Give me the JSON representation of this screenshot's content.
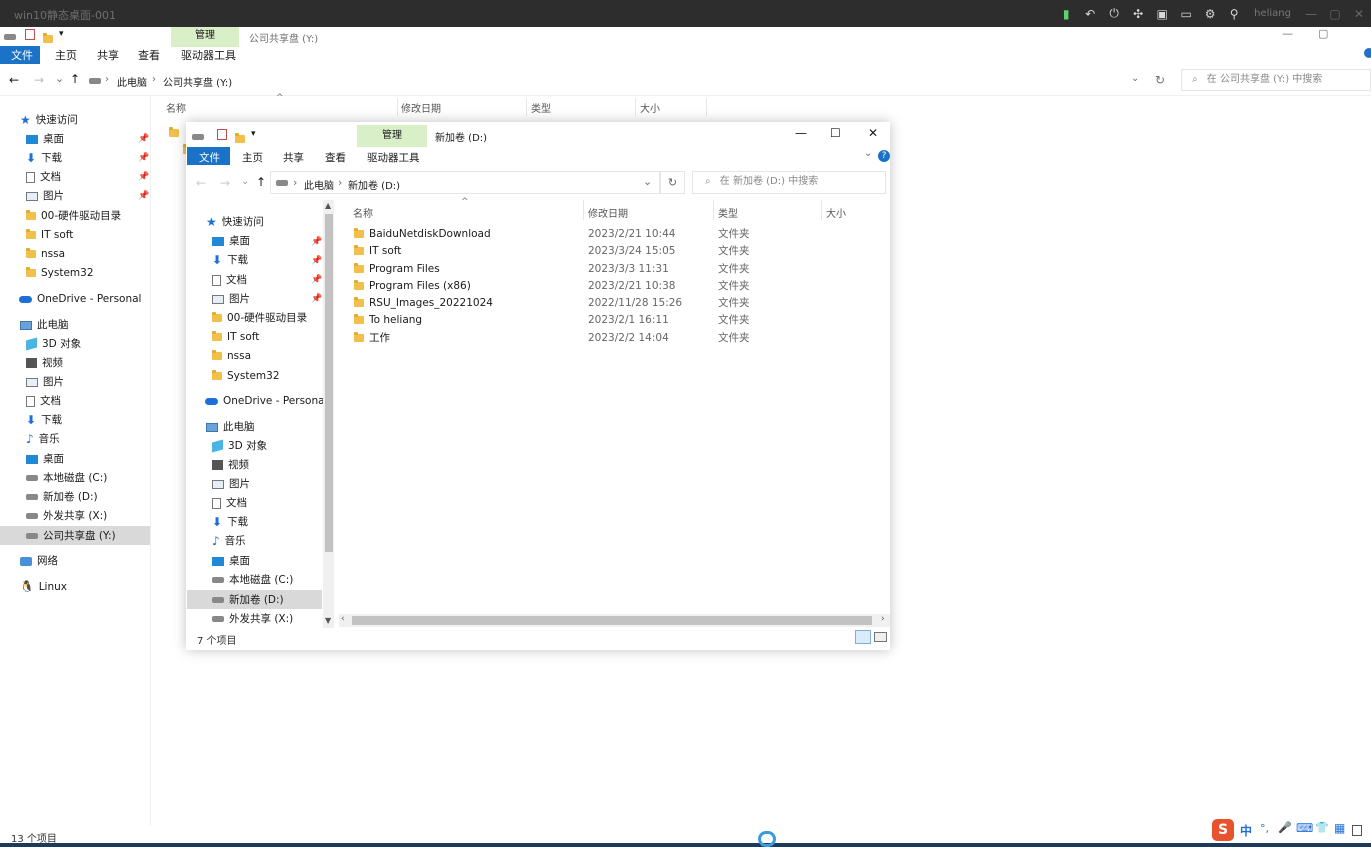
{
  "remote": {
    "title": "win10静态桌面-001",
    "user": "heliang",
    "tray_icons": [
      "signal-icon",
      "back-icon",
      "power-icon",
      "share-icon",
      "clipboard-icon",
      "window-icon",
      "gear-icon",
      "person-icon"
    ],
    "controls": [
      "—",
      "▢",
      "✕"
    ]
  },
  "outer": {
    "qat": "▾",
    "manage_tab": "管理",
    "window_title": "公司共享盘 (Y:)",
    "tabs": {
      "file": "文件",
      "home": "主页",
      "share": "共享",
      "view": "查看",
      "drive_tools": "驱动器工具"
    },
    "win_min": "—",
    "win_max": "▢",
    "nav": {
      "back": "←",
      "forward": "→",
      "recent": "⌄",
      "up": "↑"
    },
    "breadcrumb": [
      "此电脑",
      "公司共享盘 (Y:)"
    ],
    "search_placeholder": "在 公司共享盘 (Y:) 中搜索",
    "columns": {
      "name": "名称",
      "date": "修改日期",
      "type": "类型",
      "size": "大小"
    },
    "sidebar": {
      "quick_access": "快速访问",
      "quick_items": [
        "桌面",
        "下载",
        "文档",
        "图片",
        "00-硬件驱动目录",
        "IT soft",
        "nssa",
        "System32"
      ],
      "onedrive": "OneDrive - Personal",
      "this_pc": "此电脑",
      "pc_items": [
        "3D 对象",
        "视频",
        "图片",
        "文档",
        "下载",
        "音乐",
        "桌面",
        "本地磁盘 (C:)",
        "新加卷 (D:)",
        "外发共享 (X:)",
        "公司共享盘 (Y:)"
      ],
      "network": "网络",
      "linux": "Linux"
    },
    "status": "13 个项目"
  },
  "inner": {
    "manage_tab": "管理",
    "window_title": "新加卷 (D:)",
    "controls": {
      "min": "—",
      "max": "☐",
      "close": "✕"
    },
    "tabs": {
      "file": "文件",
      "home": "主页",
      "share": "共享",
      "view": "查看",
      "drive_tools": "驱动器工具"
    },
    "breadcrumb": [
      "此电脑",
      "新加卷 (D:)"
    ],
    "search_placeholder": "在 新加卷 (D:) 中搜索",
    "columns": {
      "name": "名称",
      "date": "修改日期",
      "type": "类型",
      "size": "大小"
    },
    "rows": [
      {
        "name": "BaiduNetdiskDownload",
        "date": "2023/2/21 10:44",
        "type": "文件夹"
      },
      {
        "name": "IT soft",
        "date": "2023/3/24 15:05",
        "type": "文件夹"
      },
      {
        "name": "Program Files",
        "date": "2023/3/3 11:31",
        "type": "文件夹"
      },
      {
        "name": "Program Files (x86)",
        "date": "2023/2/21 10:38",
        "type": "文件夹"
      },
      {
        "name": "RSU_Images_20221024",
        "date": "2022/11/28 15:26",
        "type": "文件夹"
      },
      {
        "name": "To heliang",
        "date": "2023/2/1 16:11",
        "type": "文件夹"
      },
      {
        "name": "工作",
        "date": "2023/2/2 14:04",
        "type": "文件夹"
      }
    ],
    "sidebar": {
      "quick_access": "快速访问",
      "quick_items": [
        "桌面",
        "下载",
        "文档",
        "图片",
        "00-硬件驱动目录",
        "IT soft",
        "nssa",
        "System32"
      ],
      "onedrive": "OneDrive - Personal",
      "this_pc": "此电脑",
      "pc_items": [
        "3D 对象",
        "视频",
        "图片",
        "文档",
        "下载",
        "音乐",
        "桌面",
        "本地磁盘 (C:)",
        "新加卷 (D:)",
        "外发共享 (X:)"
      ]
    },
    "status": "7 个项目"
  },
  "ime": {
    "logo": "S",
    "lang": "中",
    "items": [
      "°,",
      "🎤",
      "⌨",
      "👕",
      "▦"
    ]
  }
}
